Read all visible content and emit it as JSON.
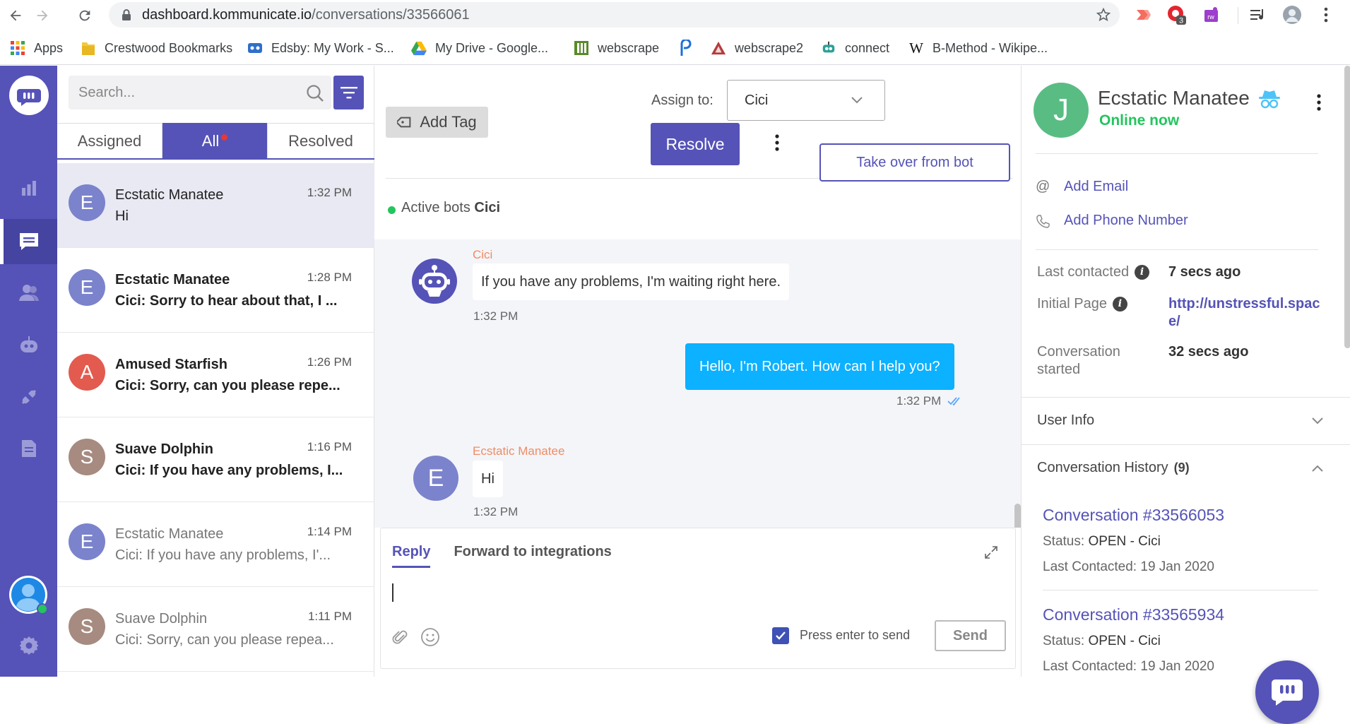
{
  "browser": {
    "url_host": "dashboard.kommunicate.io",
    "url_path": "/conversations/33566061",
    "extension_badge": "3",
    "bookmarks": [
      {
        "label": "Apps",
        "icon": "apps-grid-icon"
      },
      {
        "label": "Crestwood Bookmarks",
        "icon": "folder-icon"
      },
      {
        "label": "Edsby: My Work - S...",
        "icon": "edsby-icon"
      },
      {
        "label": "My Drive - Google...",
        "icon": "google-drive-icon"
      },
      {
        "label": "webscrape",
        "icon": "webscrape-icon"
      },
      {
        "label": "",
        "icon": "p-logo-icon"
      },
      {
        "label": "webscrape2",
        "icon": "webscrape2-icon"
      },
      {
        "label": "connect",
        "icon": "robot-icon"
      },
      {
        "label": "B-Method - Wikipe...",
        "icon": "wikipedia-icon"
      }
    ]
  },
  "sidebar": {
    "items": [
      "logo",
      "reports-icon",
      "conversations-icon",
      "users-icon",
      "bot-icon",
      "integrations-icon",
      "documents-icon"
    ],
    "active": "conversations-icon"
  },
  "conversation_list": {
    "search_placeholder": "Search...",
    "tabs": [
      "Assigned",
      "All",
      "Resolved"
    ],
    "active_tab": "All",
    "items": [
      {
        "initial": "E",
        "name": "Ecstatic Manatee",
        "time": "1:32 PM",
        "message": "Hi",
        "color": "#7b83cc",
        "state": "active"
      },
      {
        "initial": "E",
        "name": "Ecstatic Manatee",
        "time": "1:28 PM",
        "message": "Cici: Sorry to hear about that, I ...",
        "color": "#7b83cc",
        "state": "unread"
      },
      {
        "initial": "A",
        "name": "Amused Starfish",
        "time": "1:26 PM",
        "message": "Cici: Sorry, can you please repe...",
        "color": "#e35b4f",
        "state": "unread"
      },
      {
        "initial": "S",
        "name": "Suave Dolphin",
        "time": "1:16 PM",
        "message": "Cici: If you have any problems, I...",
        "color": "#a78b80",
        "state": "unread"
      },
      {
        "initial": "E",
        "name": "Ecstatic Manatee",
        "time": "1:14 PM",
        "message": "Cici: If you have any problems, I'...",
        "color": "#7b83cc",
        "state": "read"
      },
      {
        "initial": "S",
        "name": "Suave Dolphin",
        "time": "1:11 PM",
        "message": "Cici: Sorry, can you please repea...",
        "color": "#a78b80",
        "state": "read"
      }
    ]
  },
  "chat": {
    "add_tag_label": "Add Tag",
    "assign_label": "Assign to:",
    "assignee": "Cici",
    "resolve_label": "Resolve",
    "active_bots_label": "Active bots",
    "active_bot_name": "Cici",
    "take_over_label": "Take over from bot",
    "messages": [
      {
        "sender": "Cici",
        "text": "If you have any problems, I'm waiting right here.",
        "time": "1:32 PM"
      },
      {
        "sender": "",
        "text": "Hello, I'm Robert. How can I help you?",
        "time": "1:32 PM"
      },
      {
        "sender": "Ecstatic Manatee",
        "initial": "E",
        "text": "Hi",
        "time": "1:32 PM"
      }
    ],
    "composer": {
      "tab_reply": "Reply",
      "tab_forward": "Forward to integrations",
      "enter_to_send_label": "Press enter to send",
      "enter_to_send_checked": true,
      "send_label": "Send"
    }
  },
  "user": {
    "initial": "J",
    "name": "Ecstatic Manatee",
    "status": "Online now",
    "add_email": "Add Email",
    "add_phone": "Add Phone Number",
    "last_contacted_label": "Last contacted",
    "last_contacted_value": "7 secs ago",
    "initial_page_label": "Initial Page",
    "initial_page_value": "http://unstressful.space/",
    "conversation_started_label": "Conversation started",
    "conversation_started_value": "32 secs ago",
    "user_info_label": "User Info",
    "history_label": "Conversation History",
    "history_count": "(9)",
    "history": [
      {
        "title": "Conversation #33566053",
        "status_label": "Status:",
        "status": "OPEN",
        "agent": "- Cici",
        "last_label": "Last Contacted:",
        "last": "19 Jan 2020"
      },
      {
        "title": "Conversation #33565934",
        "status_label": "Status:",
        "status": "OPEN",
        "agent": "- Cici",
        "last_label": "Last Contacted:",
        "last": "19 Jan 2020"
      }
    ]
  },
  "colors": {
    "brand": "#5553b7",
    "outgoing_bubble": "#0cb1ff",
    "online": "#22c55e"
  }
}
